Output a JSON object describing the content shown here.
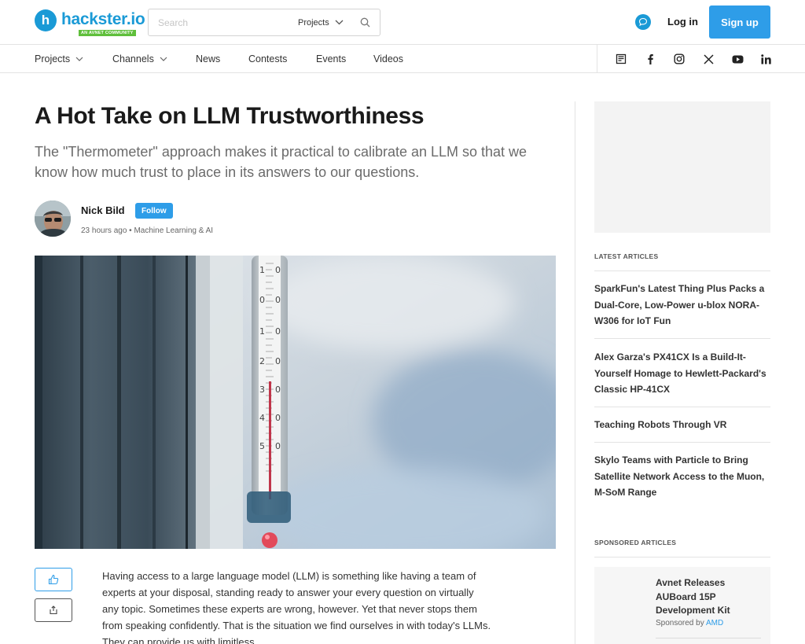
{
  "header": {
    "logo_mark": "h",
    "logo_text": "hackster.io",
    "logo_subtext": "AN AVNET COMMUNITY",
    "search_placeholder": "Search",
    "search_scope": "Projects",
    "login_label": "Log in",
    "signup_label": "Sign up"
  },
  "nav": {
    "items": [
      "Projects",
      "Channels",
      "News",
      "Contests",
      "Events",
      "Videos"
    ],
    "social_icons": [
      "news-icon",
      "facebook-icon",
      "instagram-icon",
      "x-icon",
      "youtube-icon",
      "linkedin-icon"
    ]
  },
  "article": {
    "title": "A Hot Take on LLM Trustworthiness",
    "subtitle": "The \"Thermometer\" approach makes it practical to calibrate an LLM so that we know how much trust to place in its answers to our questions.",
    "author": "Nick Bild",
    "follow_label": "Follow",
    "time_ago": "23 hours ago",
    "separator": "•",
    "category": "Machine Learning & AI",
    "body": "Having access to a large language model (LLM) is something like having a team of experts at your disposal, standing ready to answer your every question on virtually any topic. Sometimes these experts are wrong, however. Yet that never stops them from speaking confidently. That is the situation we find ourselves in with today's LLMs. They can provide us with limitless"
  },
  "sidebar": {
    "latest_heading": "LATEST ARTICLES",
    "latest_articles": [
      "SparkFun's Latest Thing Plus Packs a Dual-Core, Low-Power u-blox NORA-W306 for IoT Fun",
      "Alex Garza's PX41CX Is a Build-It-Yourself Homage to Hewlett-Packard's Classic HP-41CX",
      "Teaching Robots Through VR",
      "Skylo Teams with Particle to Bring Satellite Network Access to the Muon, M-SoM Range"
    ],
    "sponsored_heading": "SPONSORED ARTICLES",
    "sponsored": {
      "title": "Avnet Releases AUBoard 15P Development Kit",
      "sponsored_by_label": "Sponsored by",
      "sponsor": "AMD"
    }
  },
  "colors": {
    "brand": "#1a9ad6",
    "button": "#2e9de8",
    "text": "#1a1a1a",
    "muted": "#6b6b6b"
  }
}
